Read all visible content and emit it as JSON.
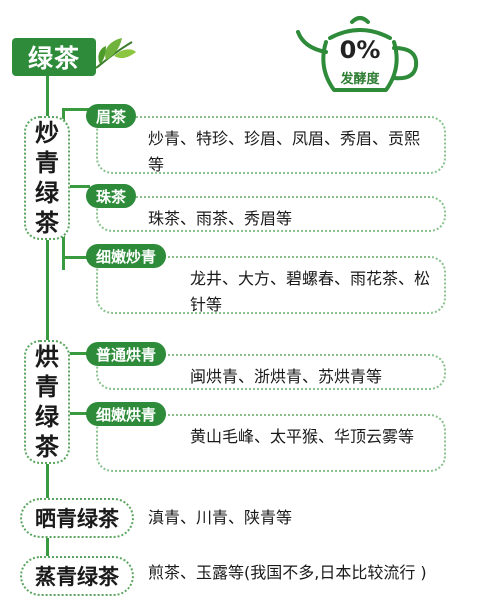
{
  "title": "绿茶",
  "badge": {
    "percent": "0%",
    "label": "发酵度"
  },
  "categories": [
    {
      "name": "炒青绿茶",
      "subs": [
        {
          "label": "眉茶",
          "text": "炒青、特珍、珍眉、凤眉、秀眉、贡熙等"
        },
        {
          "label": "珠茶",
          "text": "珠茶、雨茶、秀眉等"
        },
        {
          "label": "细嫩炒青",
          "text": "龙井、大方、碧螺春、雨花茶、松针等"
        }
      ]
    },
    {
      "name": "烘青绿茶",
      "subs": [
        {
          "label": "普通烘青",
          "text": "闽烘青、浙烘青、苏烘青等"
        },
        {
          "label": "细嫩烘青",
          "text": "黄山毛峰、太平猴、华顶云雾等"
        }
      ]
    },
    {
      "name": "晒青绿茶",
      "text": "滇青、川青、陕青等"
    },
    {
      "name": "蒸青绿茶",
      "text": "煎茶、玉露等(我国不多,日本比较流行 )"
    }
  ],
  "colors": {
    "primary": "#2e8b3a",
    "dotted": "#5aa55f"
  },
  "icons": {
    "title": "tea-leaf-icon",
    "badge": "teapot-icon"
  }
}
